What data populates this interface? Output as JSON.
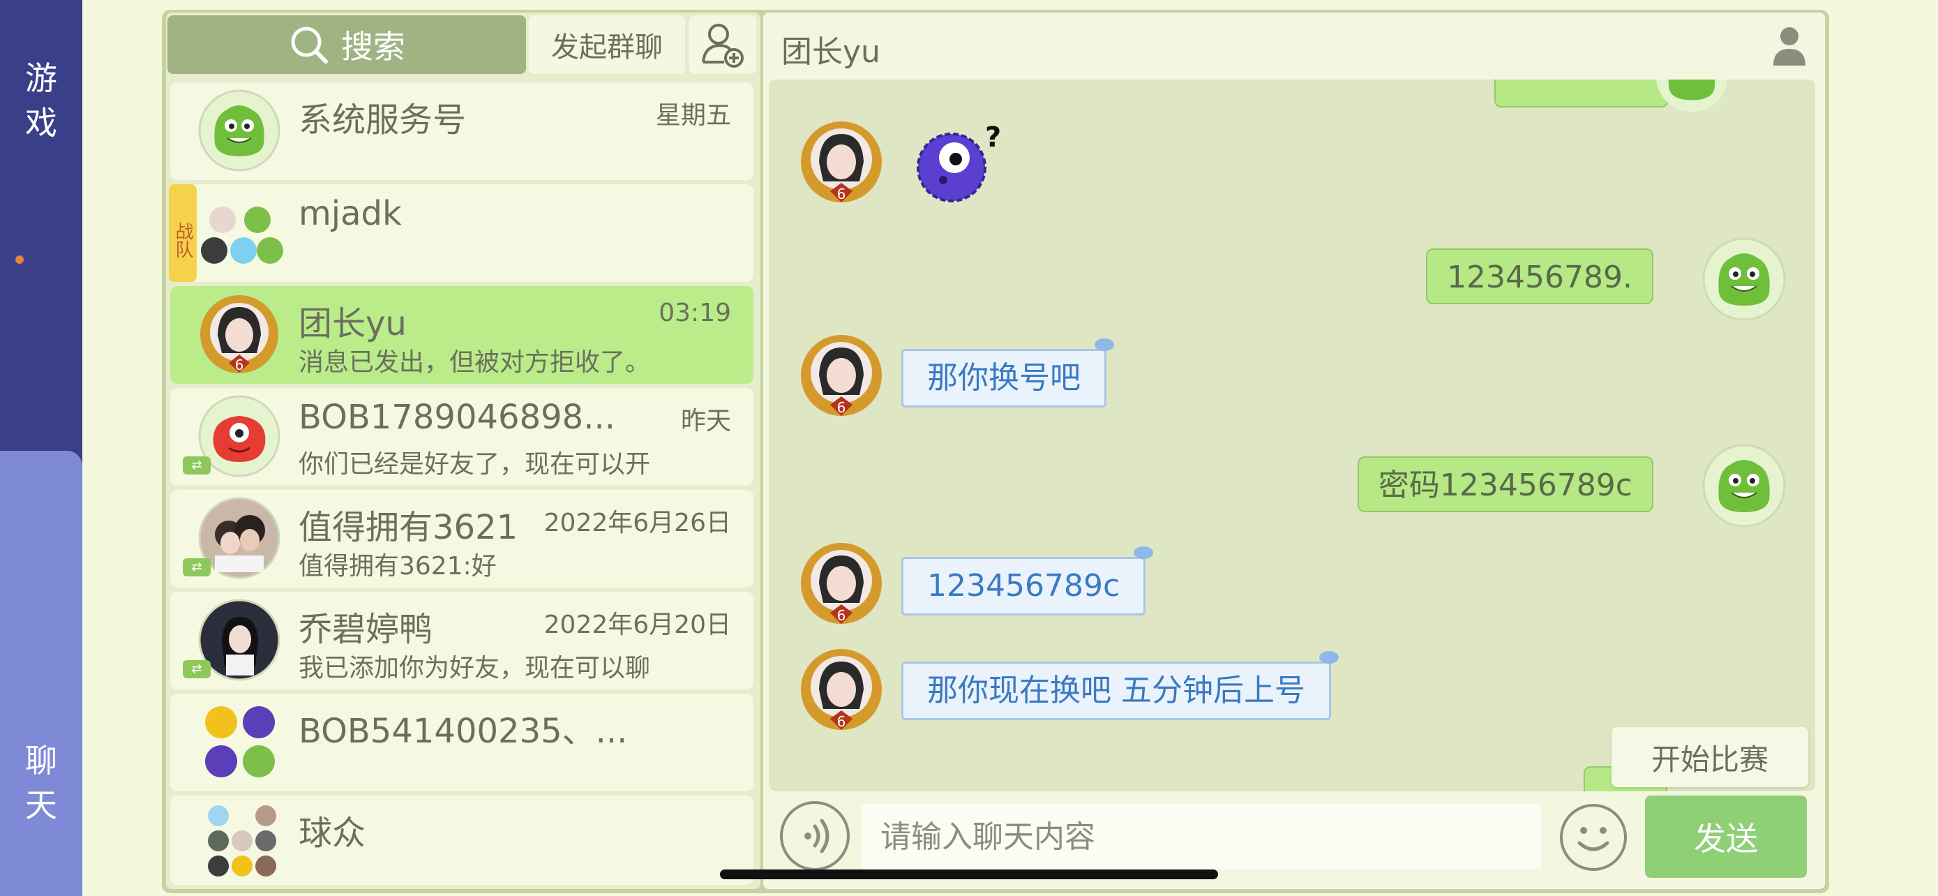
{
  "rail": {
    "game_label": "游\n戏",
    "chat_label": "聊\n天"
  },
  "search": {
    "label": "搜索"
  },
  "toolbar": {
    "group_chat_label": "发起群聊"
  },
  "conversations": [
    {
      "name": "系统服务号",
      "time": "星期五",
      "message": "",
      "avatar": "green-monster"
    },
    {
      "name": "mjadk",
      "time": "",
      "message": "",
      "tag": "战队",
      "avatar": "group"
    },
    {
      "name": "团长yu",
      "time": "03:19",
      "message": "消息已发出，但被对方拒收了。",
      "avatar": "girl-badge",
      "active": true
    },
    {
      "name": "BOB1789046898...",
      "time": "昨天",
      "message": "你们已经是好友了，现在可以开",
      "avatar": "red-monster"
    },
    {
      "name": "值得拥有3621",
      "time": "2022年6月26日",
      "message": "值得拥有3621:好",
      "avatar": "photo"
    },
    {
      "name": "乔碧婷鸭",
      "time": "2022年6月20日",
      "message": "我已添加你为好友，现在可以聊",
      "avatar": "photo"
    },
    {
      "name": "BOB541400235、...",
      "time": "",
      "message": "",
      "avatar": "group"
    },
    {
      "name": "球众",
      "time": "",
      "message": "",
      "avatar": "group"
    }
  ],
  "chat": {
    "title": "团长yu",
    "messages": [
      {
        "side": "left",
        "type": "sticker",
        "text": ""
      },
      {
        "side": "right",
        "text": "123456789."
      },
      {
        "side": "left",
        "text": "那你换号吧"
      },
      {
        "side": "right",
        "text": "密码123456789c"
      },
      {
        "side": "left",
        "text": "123456789c"
      },
      {
        "side": "left",
        "text": "那你现在换吧 五分钟后上号"
      }
    ],
    "start_match_label": "开始比赛",
    "input_placeholder": "请输入聊天内容",
    "send_label": "发送"
  },
  "colors": {
    "rail": "#3a3f86",
    "rail_active": "#7e8ad6",
    "active_conversation": "#baec8a",
    "send_button": "#8fd077",
    "bubble_right": "#b6e885",
    "bubble_left_text": "#3a79c4"
  }
}
